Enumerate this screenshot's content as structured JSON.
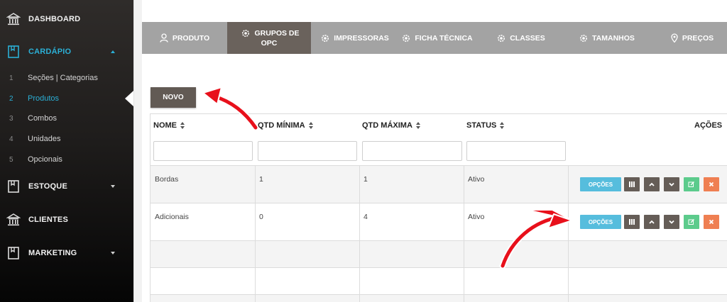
{
  "sidebar": {
    "items": [
      {
        "label": "DASHBOARD",
        "icon": "bank-icon"
      },
      {
        "label": "CARDÁPIO",
        "icon": "book-icon"
      },
      {
        "label": "ESTOQUE",
        "icon": "book-icon"
      },
      {
        "label": "CLIENTES",
        "icon": "bank-icon"
      },
      {
        "label": "MARKETING",
        "icon": "book-icon"
      }
    ],
    "submenu": [
      {
        "num": "1",
        "label": "Seções | Categorias"
      },
      {
        "num": "2",
        "label": "Produtos"
      },
      {
        "num": "3",
        "label": "Combos"
      },
      {
        "num": "4",
        "label": "Unidades"
      },
      {
        "num": "5",
        "label": "Opcionais"
      }
    ]
  },
  "tabs": [
    {
      "label": "PRODUTO",
      "icon": "user-icon"
    },
    {
      "label_line1": "GRUPOS DE",
      "label_line2": "OPC",
      "icon": "gear-icon"
    },
    {
      "label": "IMPRESSORAS",
      "icon": "gear-icon"
    },
    {
      "label": "FICHA TÉCNICA",
      "icon": "gear-icon"
    },
    {
      "label": "CLASSES",
      "icon": "gear-icon"
    },
    {
      "label": "TAMANHOS",
      "icon": "gear-icon"
    },
    {
      "label": "PREÇOS",
      "icon": "map-pin-icon"
    }
  ],
  "toolbar": {
    "new_label": "NOVO"
  },
  "table": {
    "columns": [
      "NOME",
      "QTD MÍNIMA",
      "QTD MÁXIMA",
      "STATUS",
      "AÇÕES"
    ],
    "rows": [
      {
        "nome": "Bordas",
        "min": "1",
        "max": "1",
        "status": "Ativo"
      },
      {
        "nome": "Adicionais",
        "min": "0",
        "max": "4",
        "status": "Ativo"
      }
    ],
    "action_labels": {
      "options": "OPÇÕES"
    }
  },
  "colors": {
    "accent": "#2bb0d6",
    "tab_bar": "#a3a3a3",
    "tab_active": "#6a625c",
    "button_dark": "#625a54",
    "options_button": "#56bddd",
    "edit_button": "#5ccb8c",
    "delete_button": "#ef7f52",
    "annotation_arrow": "#e8101b"
  }
}
